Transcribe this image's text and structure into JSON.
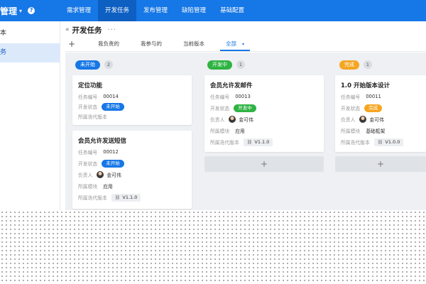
{
  "header": {
    "brand": "管理",
    "brand_caret": "▾",
    "help_glyph": "?",
    "nav": [
      "需求管理",
      "开发任务",
      "发布管理",
      "缺陷管理",
      "基础配置"
    ],
    "active_nav": 1
  },
  "sidebar": {
    "items": [
      "本",
      "务"
    ]
  },
  "page": {
    "back_glyph": "«",
    "title": "开发任务",
    "more_glyph": "···",
    "add_glyph": "+",
    "tabs": [
      "我负责的",
      "我参与的",
      "当前版本",
      "全部"
    ],
    "tab_caret": "▾"
  },
  "colors": {
    "nav_blue": "#1677e6",
    "todo": "#1677e6",
    "doing": "#2fb343",
    "done": "#f5a623"
  },
  "board": {
    "add_glyph": "+",
    "link_glyph": "⛓",
    "columns": [
      {
        "status": "未开始",
        "count": "2",
        "cards": [
          {
            "title": "定位功能",
            "id_label": "任务编号",
            "id": "00014",
            "status_label": "开发状态",
            "status": "未开始",
            "version_label": "所属迭代版本"
          },
          {
            "title": "会员允许发送短信",
            "id_label": "任务编号",
            "id": "00012",
            "status_label": "开发状态",
            "status": "未开始",
            "owner_label": "负责人",
            "owner": "金可伟",
            "module_label": "所属模块",
            "module": "应用",
            "version_label": "所属迭代版本",
            "version": "V1.1.0"
          }
        ]
      },
      {
        "status": "开发中",
        "count": "1",
        "cards": [
          {
            "title": "会员允许发邮件",
            "id_label": "任务编号",
            "id": "00013",
            "status_label": "开发状态",
            "status": "开发中",
            "owner_label": "负责人",
            "owner": "金可伟",
            "module_label": "所属模块",
            "module": "应用",
            "version_label": "所属迭代版本",
            "version": "V1.1.0"
          }
        ]
      },
      {
        "status": "完成",
        "count": "1",
        "cards": [
          {
            "title": "1.0 开始版本设计",
            "id_label": "任务编号",
            "id": "00011",
            "status_label": "开发状态",
            "status": "完成",
            "owner_label": "负责人",
            "owner": "金可伟",
            "module_label": "所属模块",
            "module": "基础框架",
            "version_label": "所属迭代版本",
            "version": "V1.0.0"
          }
        ]
      }
    ]
  }
}
